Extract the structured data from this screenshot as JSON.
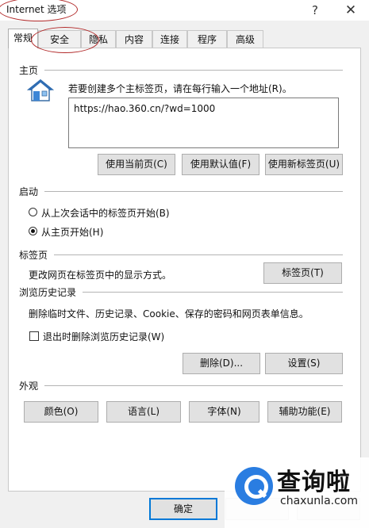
{
  "window": {
    "title": "Internet 选项",
    "help_glyph": "?",
    "close_glyph": "✕"
  },
  "tabs": [
    {
      "label": "常规",
      "active": true
    },
    {
      "label": "安全"
    },
    {
      "label": "隐私"
    },
    {
      "label": "内容"
    },
    {
      "label": "连接"
    },
    {
      "label": "程序"
    },
    {
      "label": "高级"
    }
  ],
  "home": {
    "title": "主页",
    "description": "若要创建多个主标签页，请在每行输入一个地址(R)。",
    "address": "https://hao.360.cn/?wd=1000",
    "buttons": [
      "使用当前页(C)",
      "使用默认值(F)",
      "使用新标签页(U)"
    ]
  },
  "startup": {
    "title": "启动",
    "options": [
      {
        "label": "从上次会话中的标签页开始(B)",
        "selected": false
      },
      {
        "label": "从主页开始(H)",
        "selected": true
      }
    ]
  },
  "tabs_section": {
    "title": "标签页",
    "description": "更改网页在标签页中的显示方式。",
    "button": "标签页(T)"
  },
  "history": {
    "title": "浏览历史记录",
    "description": "删除临时文件、历史记录、Cookie、保存的密码和网页表单信息。",
    "checkbox_label": "退出时删除浏览历史记录(W)",
    "checkbox_checked": false,
    "delete_button": "删除(D)...",
    "settings_button": "设置(S)"
  },
  "appearance": {
    "title": "外观",
    "buttons": [
      "颜色(O)",
      "语言(L)",
      "字体(N)",
      "辅助功能(E)"
    ]
  },
  "footer": {
    "ok_button": "确定"
  },
  "watermark": {
    "brand": "查询啦",
    "url": "chaxunla.com",
    "color": "#2a7de1"
  },
  "annotation_color": "#b22a2a"
}
